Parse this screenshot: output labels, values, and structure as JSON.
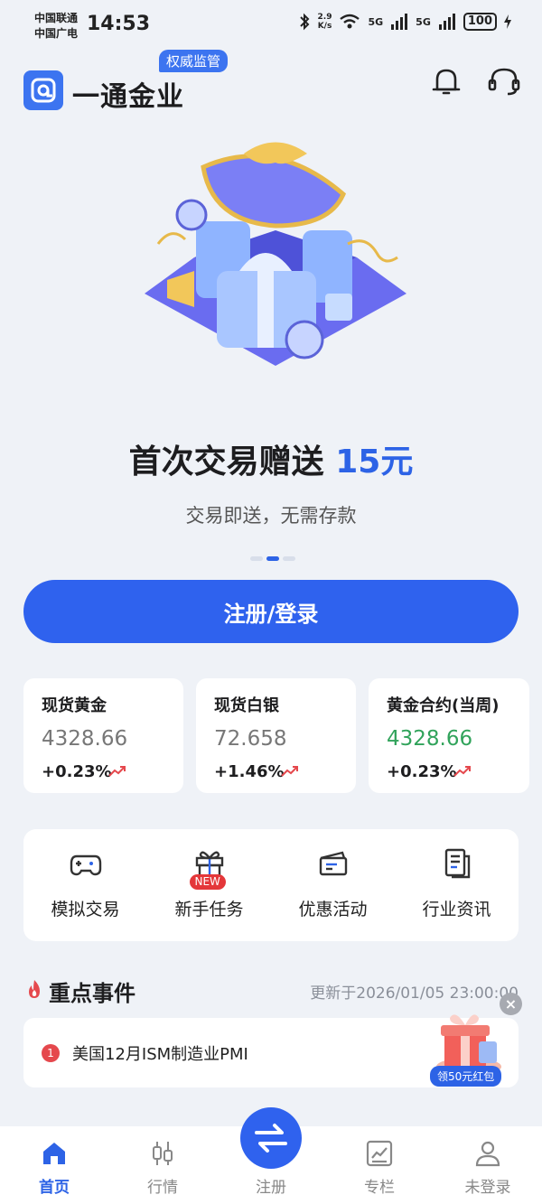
{
  "status_bar": {
    "carrier1": "中国联通",
    "carrier2": "中国广电",
    "time": "14:53",
    "speed_value": "2.9",
    "speed_unit": "K/s",
    "network1": "5G",
    "network2": "5G",
    "battery": "100"
  },
  "header": {
    "app_name": "一通金业",
    "badge": "权威监管",
    "icons": [
      "bell-icon",
      "headset-icon"
    ]
  },
  "banner": {
    "title_prefix": "首次交易赠送",
    "title_highlight": "15元",
    "subtitle": "交易即送，无需存款",
    "active_slide": 1,
    "slide_count": 3
  },
  "cta": {
    "label": "注册/登录"
  },
  "quotes": [
    {
      "name": "现货黄金",
      "price": "4328.66",
      "change": "+0.23%",
      "price_color": "#777777"
    },
    {
      "name": "现货白银",
      "price": "72.658",
      "change": "+1.46%",
      "price_color": "#777777"
    },
    {
      "name": "黄金合约(当周)",
      "price": "4328.66",
      "change": "+0.23%",
      "price_color": "#31a35b"
    }
  ],
  "menu": [
    {
      "label": "模拟交易",
      "icon": "gamepad-icon"
    },
    {
      "label": "新手任务",
      "icon": "gift-icon",
      "tag": "NEW"
    },
    {
      "label": "优惠活动",
      "icon": "ticket-icon"
    },
    {
      "label": "行业资讯",
      "icon": "news-icon"
    }
  ],
  "events": {
    "title": "重点事件",
    "updated": "更新于2026/01/05 23:00:00",
    "items": [
      {
        "rank": "1",
        "text": "美国12月ISM制造业PMI"
      }
    ]
  },
  "float_ad": {
    "label": "领50元红包"
  },
  "tabs": [
    {
      "label": "首页",
      "icon": "home-icon",
      "active": true
    },
    {
      "label": "行情",
      "icon": "candlestick-icon",
      "active": false
    },
    {
      "label": "注册",
      "icon": "swap-icon",
      "active": false
    },
    {
      "label": "专栏",
      "icon": "chart-icon",
      "active": false
    },
    {
      "label": "未登录",
      "icon": "user-icon",
      "active": false
    }
  ],
  "colors": {
    "accent": "#2f62ee",
    "up": "#e5484d",
    "green": "#31a35b"
  }
}
